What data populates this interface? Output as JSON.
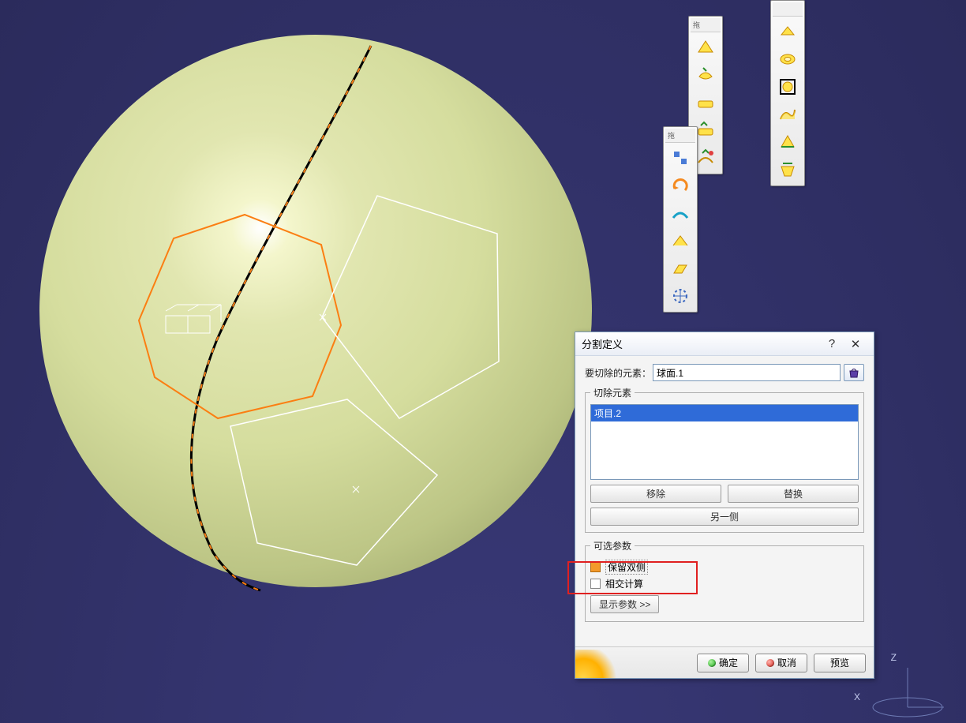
{
  "dialog": {
    "title": "分割定义",
    "help_label": "?",
    "close_label": "✕",
    "element_to_cut_label": "要切除的元素：",
    "element_to_cut_value": "球面.1",
    "cutting_elements_legend": "切除元素",
    "cutting_elements": [
      "项目.2"
    ],
    "remove_btn": "移除",
    "replace_btn": "替换",
    "other_side_btn": "另一侧",
    "optional_legend": "可选参数",
    "keep_both_sides_label": "保留双侧",
    "intersection_calc_label": "相交计算",
    "show_params_btn": "显示参数 >>",
    "ok_btn": "确定",
    "cancel_btn": "取消",
    "preview_btn": "预览"
  },
  "toolbars": {
    "a_label": "拖",
    "b_label": "拖",
    "c_label": ""
  },
  "compass": {
    "x": "X",
    "z": "Z"
  }
}
